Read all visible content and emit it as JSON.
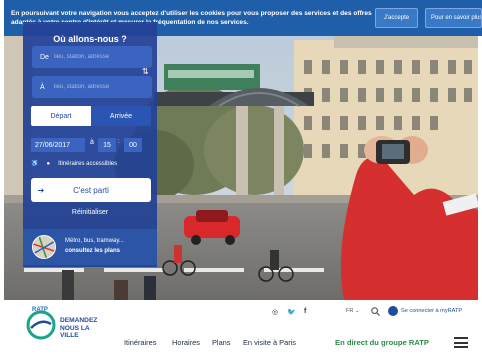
{
  "cookie_banner": {
    "text": "En poursuivant votre navigation vous acceptez d'utiliser les cookies pour vous proposer des services et des offres adaptés à votre centre d'intérêt et mesurer la fréquentation de nos services.",
    "accept_label": "J'accepte",
    "more_label": "Pour en savoir plus"
  },
  "itinerary": {
    "title": "Où allons-nous ?",
    "from_label": "De",
    "from_placeholder": "lieu, station, adresse",
    "to_label": "À",
    "to_placeholder": "lieu, station, adresse",
    "mode_selected": "Départ",
    "mode_other": "Arrivée",
    "date": "27/06/2017",
    "at": "à",
    "hour": "15",
    "minute": "00",
    "accessible_label": "Itinéraires accessibles",
    "go_label": "C'est parti",
    "reset_label": "Réinitialiser"
  },
  "map_promo": {
    "line1": "Métro, bus, tramway...",
    "line2": "consultez les plans"
  },
  "header": {
    "brand_small": "RATP",
    "slogan": "DEMANDEZ NOUS LA VILLE",
    "language": "FR",
    "login_label": "Se connecter à myRATP",
    "nav": [
      "Itinéraires",
      "Horaires",
      "Plans",
      "En visite à Paris"
    ],
    "live_label": "En direct du groupe RATP"
  },
  "icons": {
    "social": [
      "instagram-icon",
      "twitter-icon",
      "facebook-icon"
    ]
  },
  "colors": {
    "brand_blue": "#1f4d9e",
    "banner_blue": "#1f5ea8",
    "panel_blue": "#224296",
    "live_green": "#2e8b45",
    "logo_teal": "#19a58a"
  }
}
